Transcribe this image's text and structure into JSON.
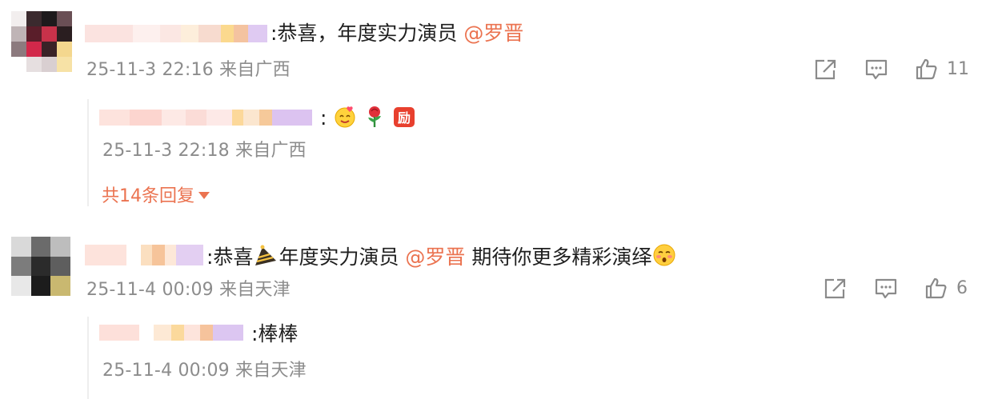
{
  "comments": [
    {
      "text": ":恭喜，年度实力演员",
      "mention": "@罗晋",
      "meta": "25-11-3 22:16 来自广西",
      "likes": "11",
      "reply": {
        "text": ":",
        "emojis": [
          "smile-heart-emoji",
          "rose-emoji",
          "encourage-emoji"
        ],
        "meta": "25-11-3 22:18 来自广西"
      },
      "more_replies": "共14条回复"
    },
    {
      "text_before": ":恭喜",
      "text_middle": "年度实力演员",
      "mention": "@罗晋",
      "text_after": "期待你更多精彩演绎",
      "emojis": [
        "party-hat-emoji",
        "blush-emoji"
      ],
      "meta": "25-11-4 00:09 来自天津",
      "likes": "6",
      "reply": {
        "text": ":棒棒",
        "meta": "25-11-4 00:09 来自天津"
      }
    }
  ],
  "icons": [
    "share-icon",
    "comment-icon",
    "like-icon"
  ],
  "colors": {
    "mention": "#eb7350",
    "meta": "#8c8c8c",
    "icon": "#8a8a8a"
  }
}
